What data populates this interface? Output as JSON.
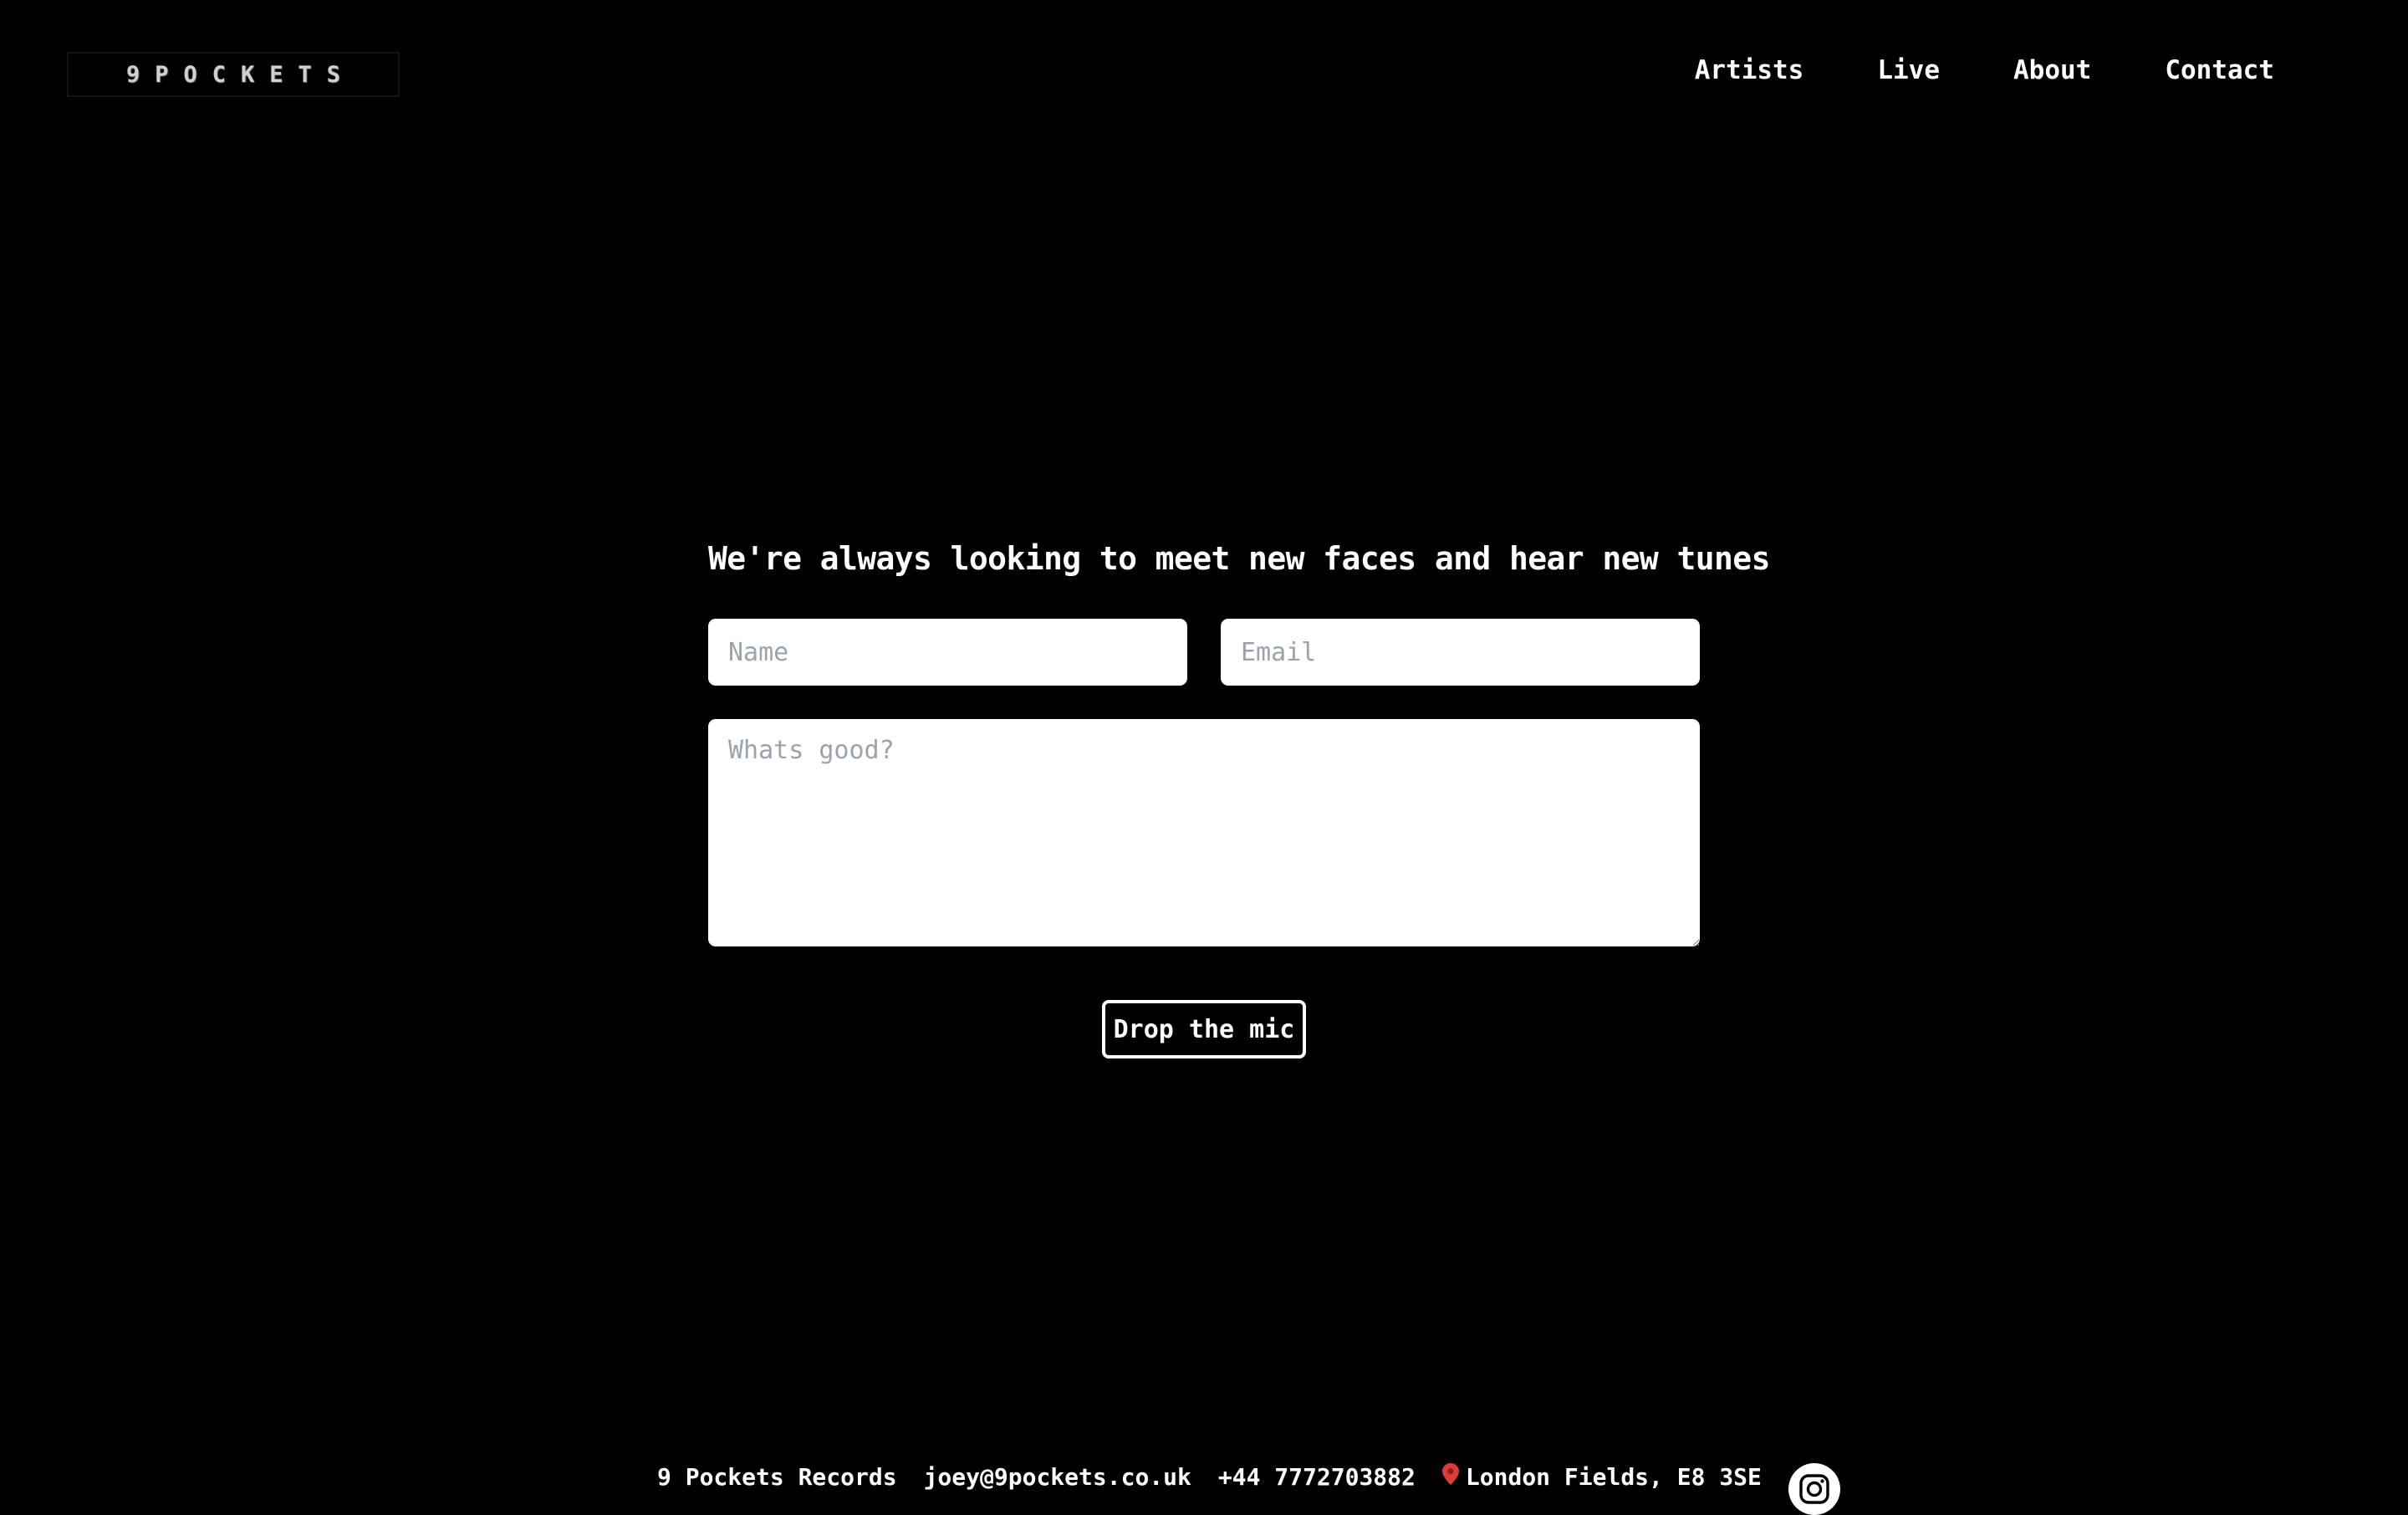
{
  "brand": {
    "logo_text": "9POCKETS"
  },
  "nav": {
    "items": [
      {
        "label": "Artists"
      },
      {
        "label": "Live"
      },
      {
        "label": "About"
      },
      {
        "label": "Contact"
      }
    ]
  },
  "contact": {
    "heading": "We're always looking to meet new faces and hear new tunes",
    "name_placeholder": "Name",
    "name_value": "",
    "email_placeholder": "Email",
    "email_value": "",
    "message_placeholder": "Whats good?",
    "message_value": "",
    "submit_label": "Drop the mic"
  },
  "footer": {
    "company": "9 Pockets Records",
    "email": "joey@9pockets.co.uk",
    "phone": "+44 7772703882",
    "location": "London Fields, E8 3SE",
    "location_icon": "map-pin-icon",
    "social_icon": "instagram-icon"
  },
  "colors": {
    "background": "#000000",
    "text": "#ffffff",
    "field_background": "#ffffff",
    "placeholder": "#9aa3ad"
  }
}
